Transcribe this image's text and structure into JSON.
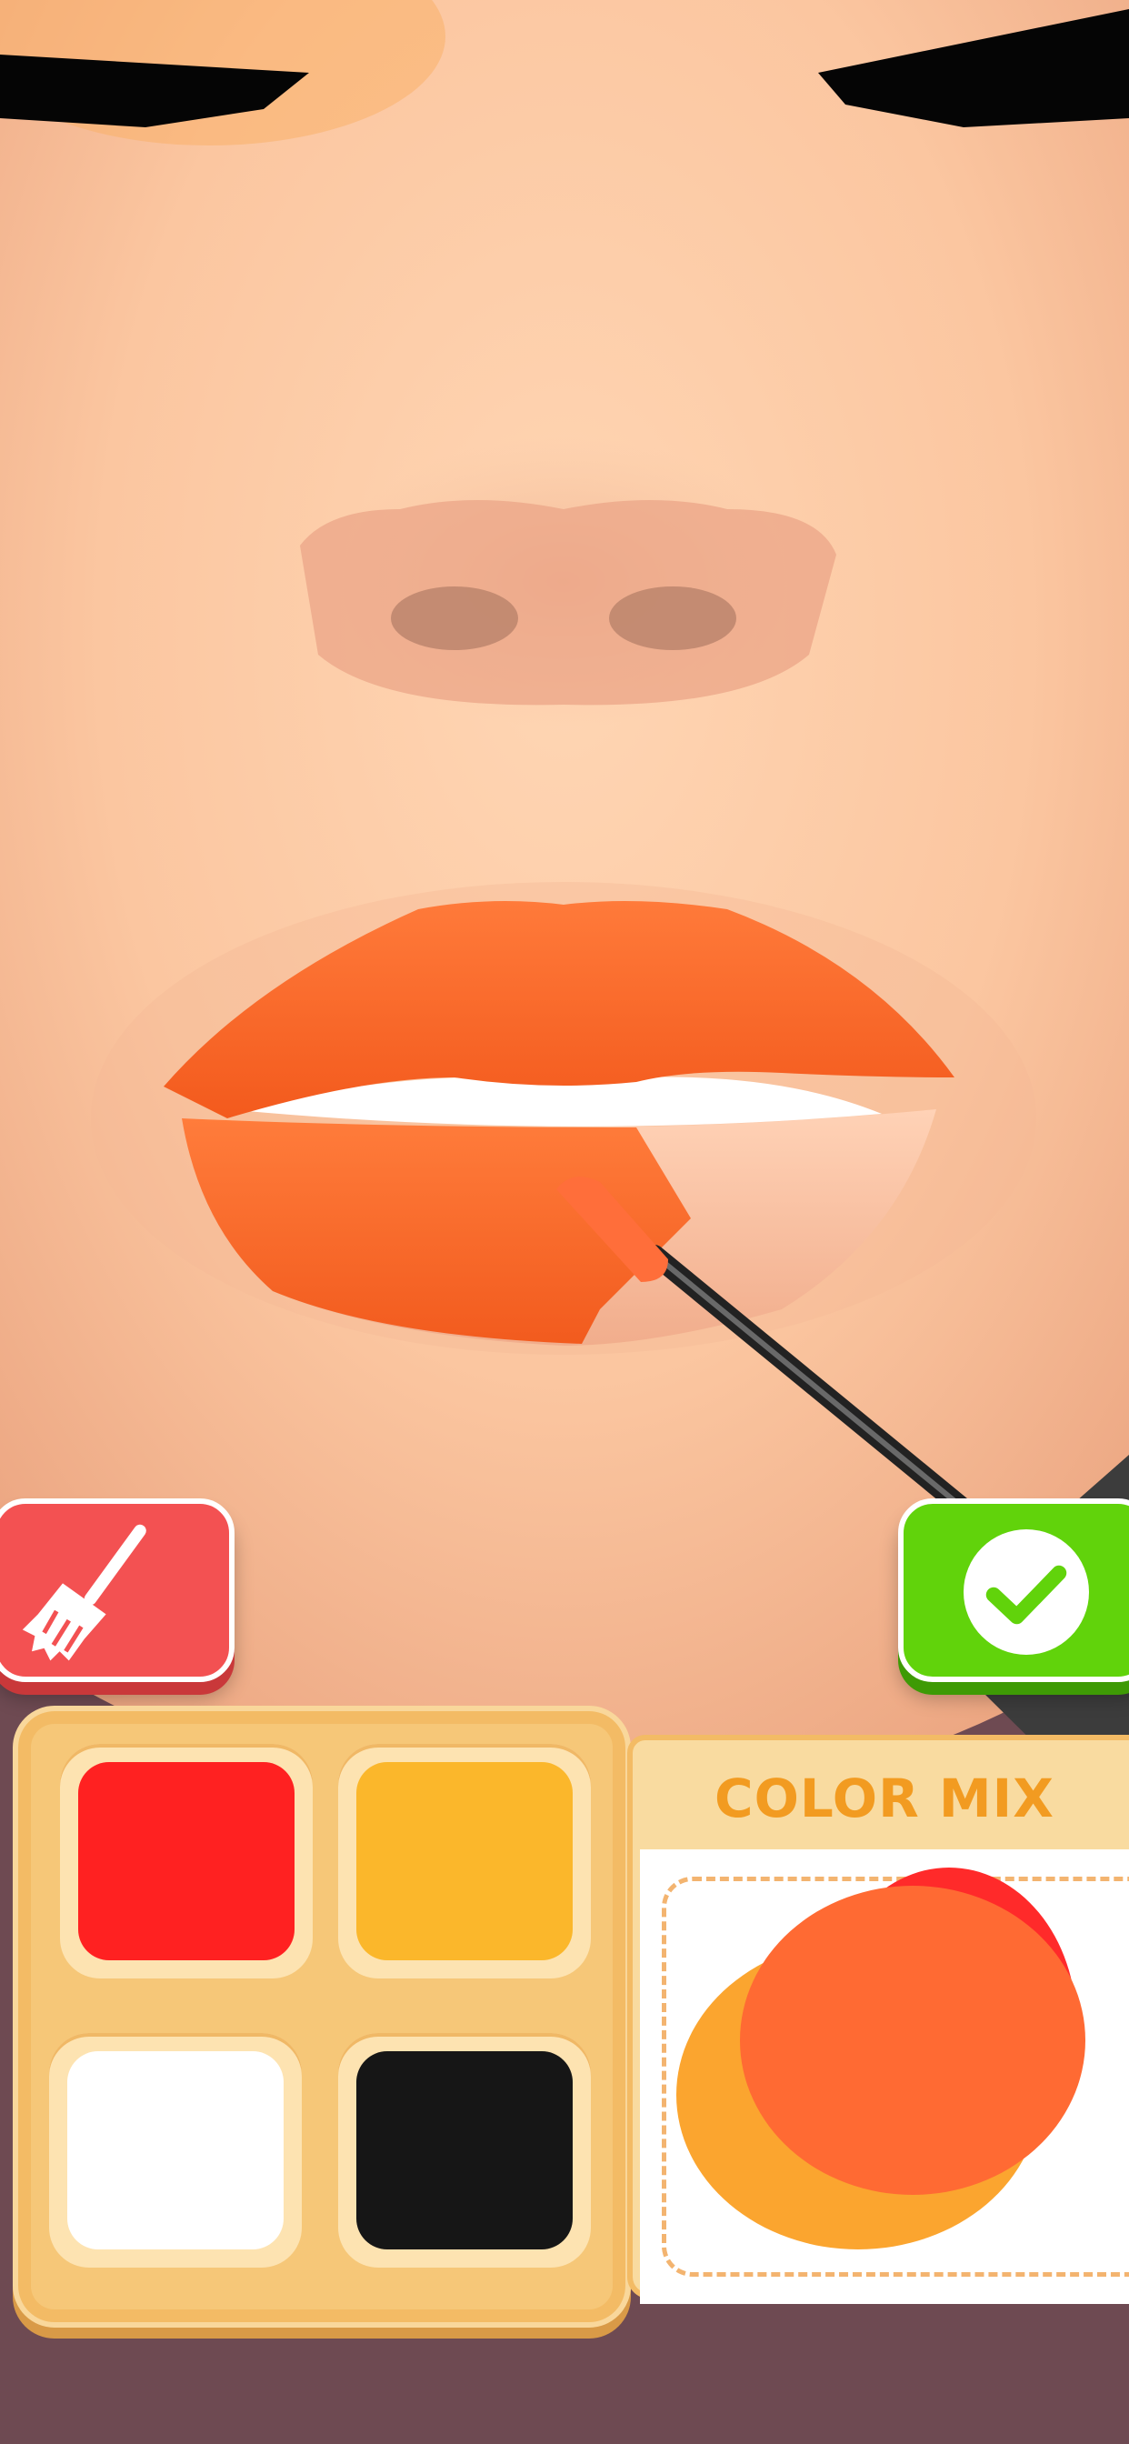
{
  "game": {
    "color_mix_label": "COLOR MIX",
    "clear_button_icon": "broom-icon",
    "done_button_icon": "checkmark-icon",
    "palette_colors": [
      {
        "name": "red",
        "hex": "#ff2121"
      },
      {
        "name": "yellow",
        "hex": "#fbb72b"
      },
      {
        "name": "white",
        "hex": "#ffffff"
      },
      {
        "name": "black",
        "hex": "#161616"
      }
    ],
    "mixed_color": "#ff6a33"
  }
}
